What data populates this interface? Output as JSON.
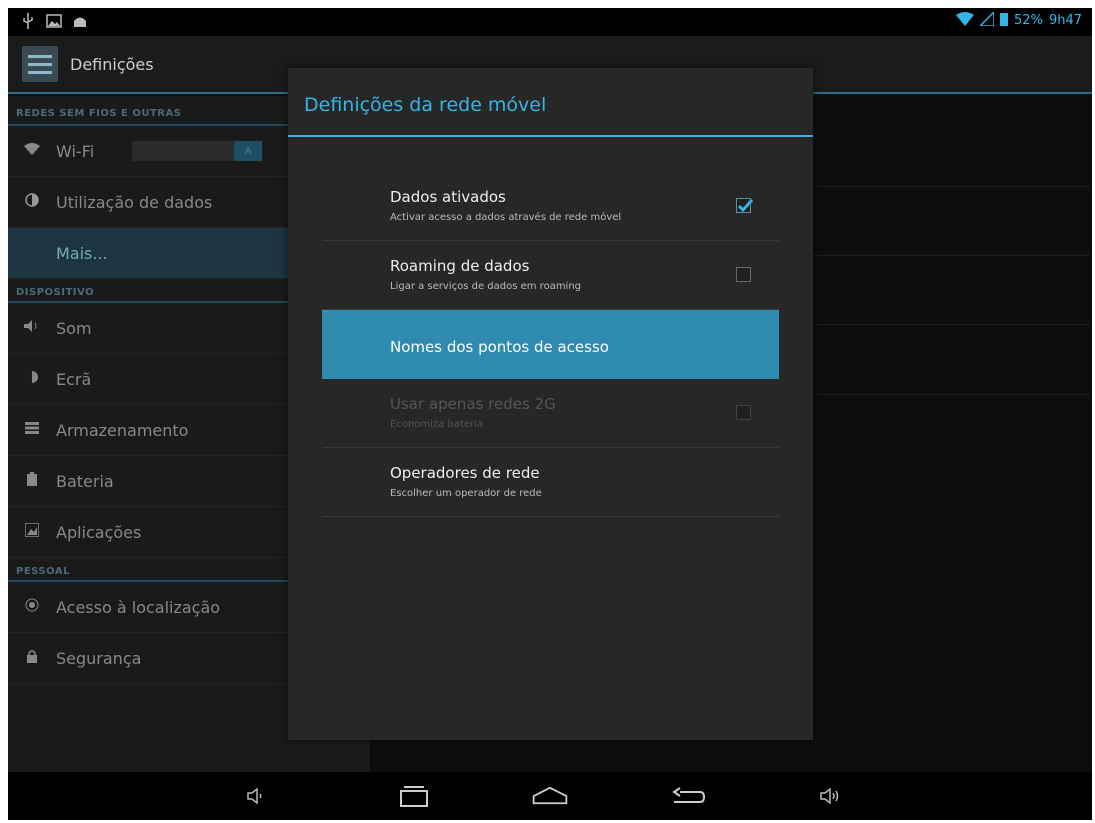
{
  "status_bar": {
    "left_icons": [
      "usb-icon",
      "image-icon",
      "android-debug-icon"
    ],
    "battery": "52%",
    "time": "9h47"
  },
  "action_bar": {
    "title": "Definições"
  },
  "sidebar": {
    "sections": [
      {
        "header": "REDES SEM FIOS E OUTRAS",
        "items": [
          {
            "label": "Wi-Fi",
            "icon": "wifi-icon",
            "toggle_label": "A"
          },
          {
            "label": "Utilização de dados",
            "icon": "data-usage-icon"
          },
          {
            "label": "Mais...",
            "icon": "",
            "selected": true
          }
        ]
      },
      {
        "header": "DISPOSITIVO",
        "items": [
          {
            "label": "Som",
            "icon": "speaker-icon"
          },
          {
            "label": "Ecrã",
            "icon": "brightness-icon"
          },
          {
            "label": "Armazenamento",
            "icon": "storage-icon"
          },
          {
            "label": "Bateria",
            "icon": "battery-icon"
          },
          {
            "label": "Aplicações",
            "icon": "apps-icon"
          }
        ]
      },
      {
        "header": "PESSOAL",
        "items": [
          {
            "label": "Acesso à localização",
            "icon": "location-icon"
          },
          {
            "label": "Segurança",
            "icon": "lock-icon"
          }
        ]
      }
    ]
  },
  "dialog": {
    "title": "Definições da rede móvel",
    "rows": [
      {
        "title": "Dados ativados",
        "subtitle": "Activar acesso a dados através de rede móvel",
        "checkbox": true,
        "checked": true
      },
      {
        "title": "Roaming de dados",
        "subtitle": "Ligar a serviços de dados em roaming",
        "checkbox": true,
        "checked": false
      },
      {
        "title": "Nomes dos pontos de acesso",
        "subtitle": "",
        "highlighted": true
      },
      {
        "title": "Usar apenas redes 2G",
        "subtitle": "Economiza bateria",
        "checkbox": true,
        "checked": false,
        "disabled": true
      },
      {
        "title": "Operadores de rede",
        "subtitle": "Escolher um operador de rede"
      }
    ]
  },
  "nav_bar": {
    "icons": [
      "volume-down-icon",
      "recent-apps-icon",
      "home-icon",
      "back-icon",
      "volume-up-icon"
    ]
  },
  "colors": {
    "accent": "#33b5e5",
    "highlight": "#2f8bb0",
    "dialog_bg": "#272727"
  }
}
